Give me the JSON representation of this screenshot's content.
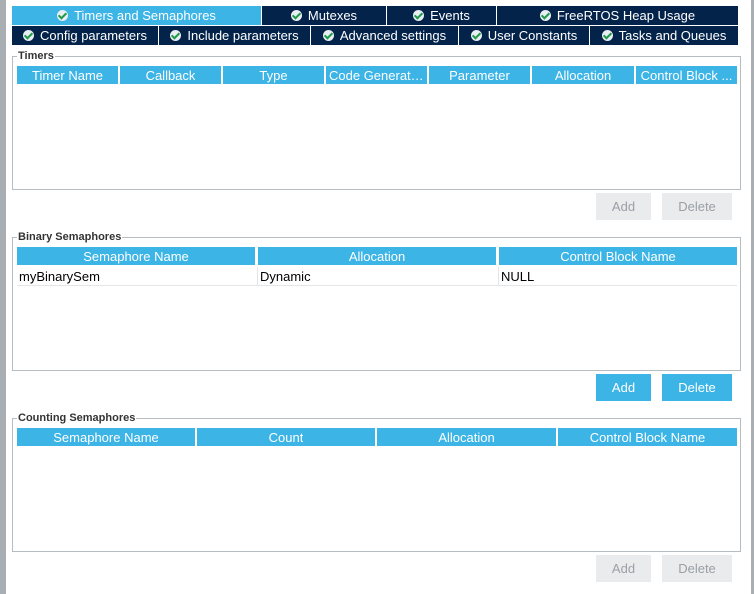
{
  "tabs_row1": [
    {
      "label": "Timers and Semaphores",
      "active": true
    },
    {
      "label": "Mutexes",
      "active": false
    },
    {
      "label": "Events",
      "active": false
    },
    {
      "label": "FreeRTOS Heap Usage",
      "active": false
    }
  ],
  "tabs_row2": [
    {
      "label": "Config parameters"
    },
    {
      "label": "Include parameters"
    },
    {
      "label": "Advanced settings"
    },
    {
      "label": "User Constants"
    },
    {
      "label": "Tasks and Queues"
    }
  ],
  "timers": {
    "title": "Timers",
    "columns": [
      "Timer Name",
      "Callback",
      "Type",
      "Code Generati...",
      "Parameter",
      "Allocation",
      "Control Block ..."
    ],
    "add_label": "Add",
    "delete_label": "Delete",
    "add_enabled": false,
    "delete_enabled": false
  },
  "binary_semaphores": {
    "title": "Binary Semaphores",
    "columns": [
      "Semaphore Name",
      "Allocation",
      "Control Block Name"
    ],
    "rows": [
      [
        "myBinarySem",
        "Dynamic",
        "NULL"
      ]
    ],
    "add_label": "Add",
    "delete_label": "Delete",
    "add_enabled": true,
    "delete_enabled": true
  },
  "counting_semaphores": {
    "title": "Counting Semaphores",
    "columns": [
      "Semaphore Name",
      "Count",
      "Allocation",
      "Control Block Name"
    ],
    "add_label": "Add",
    "delete_label": "Delete",
    "add_enabled": false,
    "delete_enabled": false
  },
  "colors": {
    "tab_dark": "#03234b",
    "accent_blue": "#3cb4e6",
    "check_green": "#1f9b4a"
  }
}
